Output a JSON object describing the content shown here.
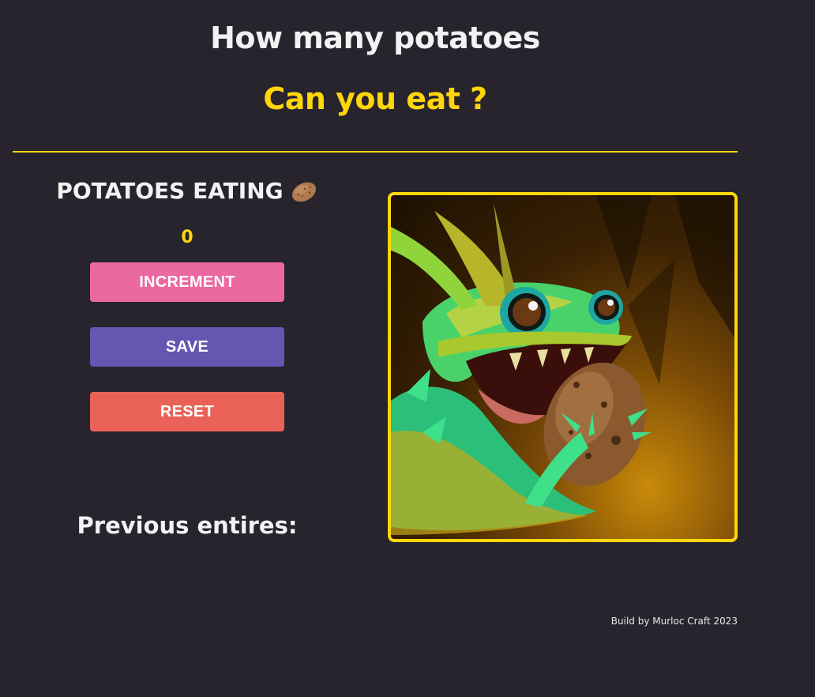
{
  "header": {
    "title": "How many potatoes",
    "subtitle": "Can you eat ?"
  },
  "counter_section": {
    "title": "POTATOES EATING",
    "title_icon": "potato-icon",
    "count": "0"
  },
  "buttons": {
    "increment_label": "INCREMENT",
    "save_label": "SAVE",
    "reset_label": "RESET"
  },
  "previous": {
    "title": "Previous entires:"
  },
  "image": {
    "alt": "murloc-eating-potato-illustration"
  },
  "footer": {
    "text": "Build by Murloc Craft 2023"
  },
  "colors": {
    "background": "#27242e",
    "accent": "#ffd60a",
    "increment": "#ec68a0",
    "save": "#6655b1",
    "reset": "#ea6257"
  }
}
